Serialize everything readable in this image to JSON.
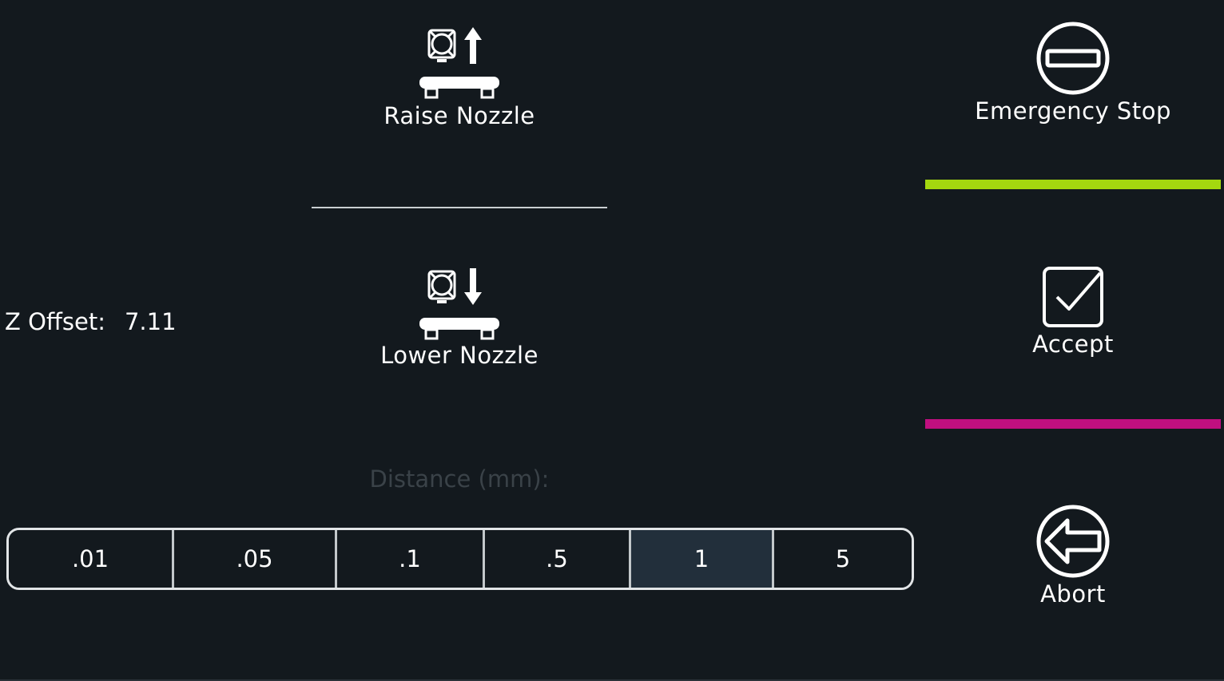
{
  "nozzle": {
    "raise_label": "Raise Nozzle",
    "raise_icon": "nozzle-up-icon",
    "lower_label": "Lower Nozzle",
    "lower_icon": "nozzle-down-icon"
  },
  "z_offset": {
    "label": "Z Offset:",
    "value": "7.11"
  },
  "distance": {
    "label": "Distance (mm):",
    "options": [
      ".01",
      ".05",
      ".1",
      ".5",
      "1",
      "5"
    ],
    "selected": "1"
  },
  "side": {
    "estop_label": "Emergency Stop",
    "estop_icon": "emergency-stop-icon",
    "accept_label": "Accept",
    "accept_icon": "checkbox-check-icon",
    "abort_label": "Abort",
    "abort_icon": "arrow-left-circle-icon"
  },
  "colors": {
    "background": "#13191e",
    "accent_green": "#a4d80f",
    "accent_magenta": "#c00f7f",
    "selected_option": "#222f3b",
    "muted_text": "#3a4248"
  }
}
